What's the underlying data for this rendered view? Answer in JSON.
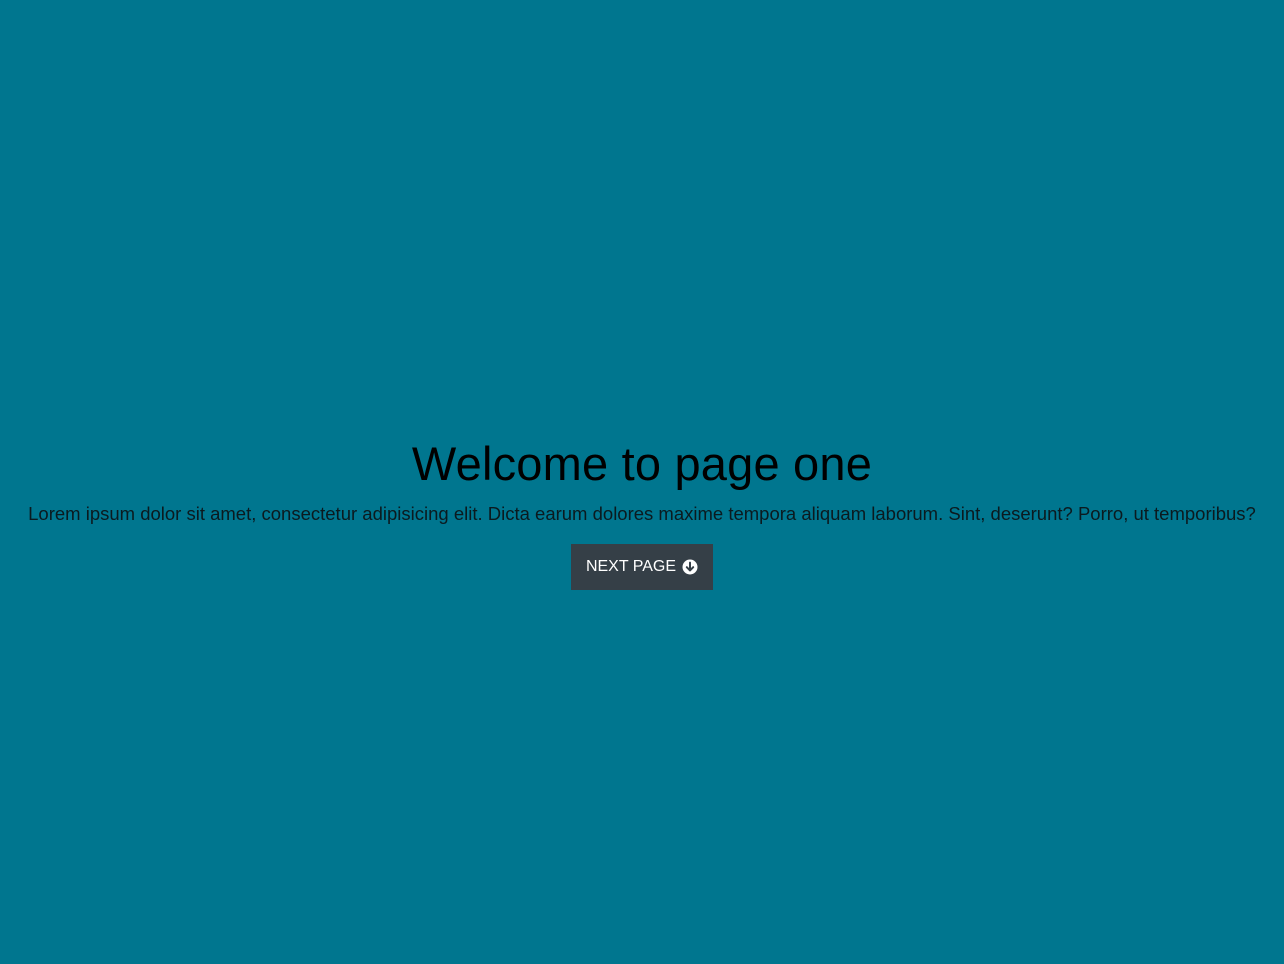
{
  "hero": {
    "title": "Welcome to page one",
    "text": "Lorem ipsum dolor sit amet, consectetur adipisicing elit. Dicta earum dolores maxime tempora aliquam laborum. Sint, deserunt? Porro, ut temporibus?",
    "button_label": "NEXT PAGE",
    "button_icon": "arrow-circle-down-icon"
  },
  "colors": {
    "background": "#00768f",
    "button_bg": "#353f47",
    "button_text": "#ffffff"
  }
}
